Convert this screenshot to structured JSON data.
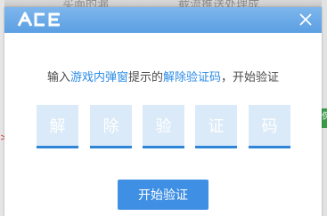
{
  "background": {
    "top_text_left": "买面的漏",
    "top_text_right": "截流推送处理成",
    "left_mark": ">",
    "right_mark": "保"
  },
  "dialog": {
    "logo_text": "ACE",
    "close_icon": "close-icon",
    "instruction": {
      "part1": "输入",
      "highlight1": "游戏内弹窗",
      "part2": "提示的",
      "highlight2": "解除验证码",
      "part3": "，开始验证"
    },
    "code_chars": [
      "解",
      "除",
      "验",
      "证",
      "码"
    ],
    "start_button_label": "开始验证"
  },
  "colors": {
    "header_blue": "#6aa9e8",
    "highlight": "#2a8ae6",
    "button": "#3f8fe4",
    "code_box": "#dbeaf8",
    "code_underline": "#2f86d8"
  }
}
